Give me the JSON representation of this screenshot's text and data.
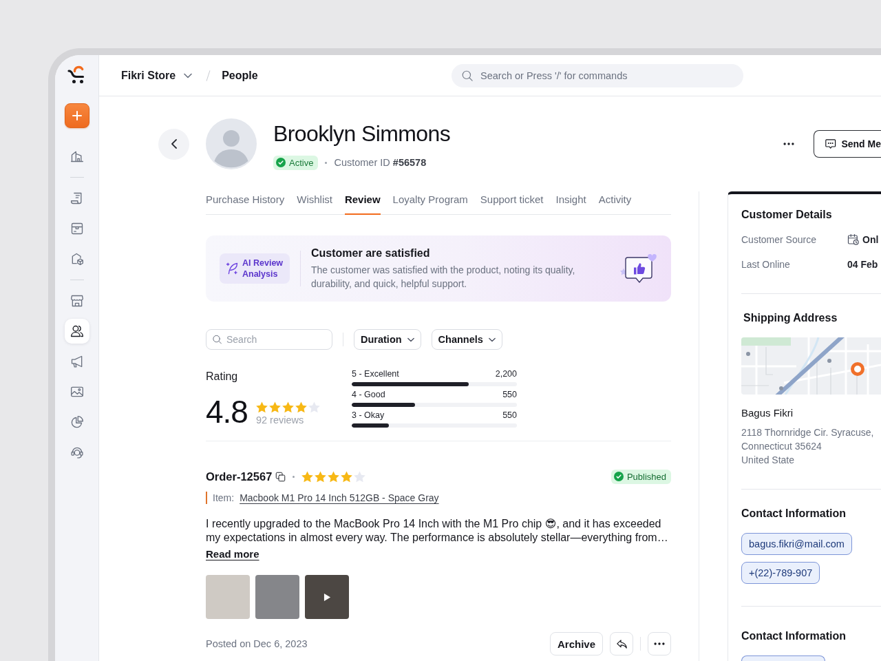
{
  "sidebar": {
    "groups": [
      [
        {
          "selected": false
        }
      ],
      [
        {
          "selected": false
        },
        {
          "selected": false
        },
        {
          "selected": false
        }
      ],
      [
        {
          "selected": false
        },
        {
          "selected": true
        },
        {
          "selected": false
        },
        {
          "selected": false
        },
        {
          "selected": false
        },
        {
          "selected": false
        }
      ]
    ]
  },
  "header": {
    "breadcrumb": {
      "store": "Fikri Store",
      "page": "People"
    },
    "search": {
      "placeholder": "Search or Press '/' for commands"
    }
  },
  "profile": {
    "name": "Brooklyn Simmons",
    "status": "Active",
    "customer_id": "Customer ID **#56578**",
    "send_button": "Send Me"
  },
  "tabs": [
    {
      "label": "Purchase History",
      "selected": false
    },
    {
      "label": "Wishlist",
      "selected": false
    },
    {
      "label": "Review",
      "selected": true
    },
    {
      "label": "Loyalty Program",
      "selected": false
    },
    {
      "label": "Support ticket",
      "selected": false
    },
    {
      "label": "Insight",
      "selected": false
    },
    {
      "label": "Activity",
      "selected": false
    }
  ],
  "ai_summary": {
    "badge": "AI Review Analysis",
    "title": "Customer are satisfied",
    "text": "The customer was satisfied with the product, noting its quality, durability, and quick, helpful support."
  },
  "filters": {
    "search": {
      "placeholder": "Search"
    },
    "dropdowns": [
      "Duration",
      "Channels"
    ]
  },
  "rating": {
    "label": "Rating",
    "score": "4.8",
    "stars": 4,
    "count": "92 reviews",
    "breakdown": [
      {
        "label": "5 - Excellent",
        "value": "2,200",
        "level": 0.71
      },
      {
        "label": "4 - Good",
        "value": "550",
        "level": 0.385
      },
      {
        "label": "3 - Okay",
        "value": "550",
        "level": 0.225
      }
    ]
  },
  "review": {
    "order": "Order-12567",
    "stars": 4,
    "status": "Published",
    "item_label": "Item:",
    "item": "Macbook M1 Pro 14 Inch 512GB - Space Gray",
    "body": "I recently upgraded to the MacBook Pro 14 Inch with the M1 Pro chip 😎, and it has exceeded my expectations in almost every way. The performance is absolutely stellar—everything from…",
    "read_more": "Read more",
    "media": [
      {
        "kind": "photo"
      },
      {
        "kind": "photo"
      },
      {
        "kind": "video"
      }
    ],
    "posted": "Posted on Dec 6, 2023",
    "archive": "Archive"
  },
  "customer_details": {
    "title": "Customer Details",
    "rows": [
      {
        "kind": "icon",
        "label": "Customer Source",
        "value": "Onl"
      },
      {
        "kind": "plain",
        "label": "Last Online",
        "value": "04 Feb"
      }
    ]
  },
  "shipping": {
    "title": "Shipping Address",
    "name": "Bagus Fikri",
    "address": [
      "2118 Thornridge Cir. Syracuse,",
      "Connecticut 35624",
      "United State"
    ]
  },
  "contacts": [
    {
      "title": "Contact Information",
      "chips": [
        "bagus.fikri@mail.com",
        "+(22)-789-907"
      ]
    },
    {
      "title": "Contact Information"
    }
  ]
}
